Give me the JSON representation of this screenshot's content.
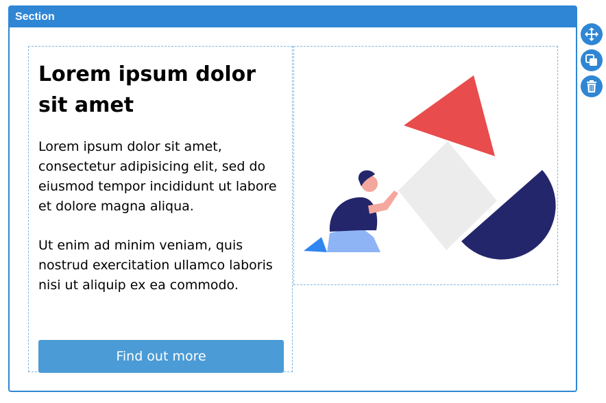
{
  "section": {
    "label": "Section"
  },
  "content": {
    "heading": "Lorem ipsum dolor sit amet",
    "paragraph1": "Lorem ipsum dolor sit amet, consectetur adipisicing elit, sed do eiusmod tempor incididunt ut labore et dolore magna aliqua.",
    "paragraph2": "Ut enim ad minim veniam, quis nostrud exercitation ullamco laboris nisi ut aliquip ex ea commodo.",
    "button_label": "Find out more"
  },
  "tools": [
    {
      "icon": "move-icon"
    },
    {
      "icon": "duplicate-icon"
    },
    {
      "icon": "trash-icon"
    }
  ],
  "colors": {
    "accent": "#2f86d4",
    "button": "#4a9bd6",
    "triangle": "#e84c4c",
    "diamond": "#ececec",
    "half_circle": "#24266c",
    "person_shirt": "#24266c",
    "person_pants": "#8fb4f5",
    "person_shoe": "#2f86f0"
  }
}
